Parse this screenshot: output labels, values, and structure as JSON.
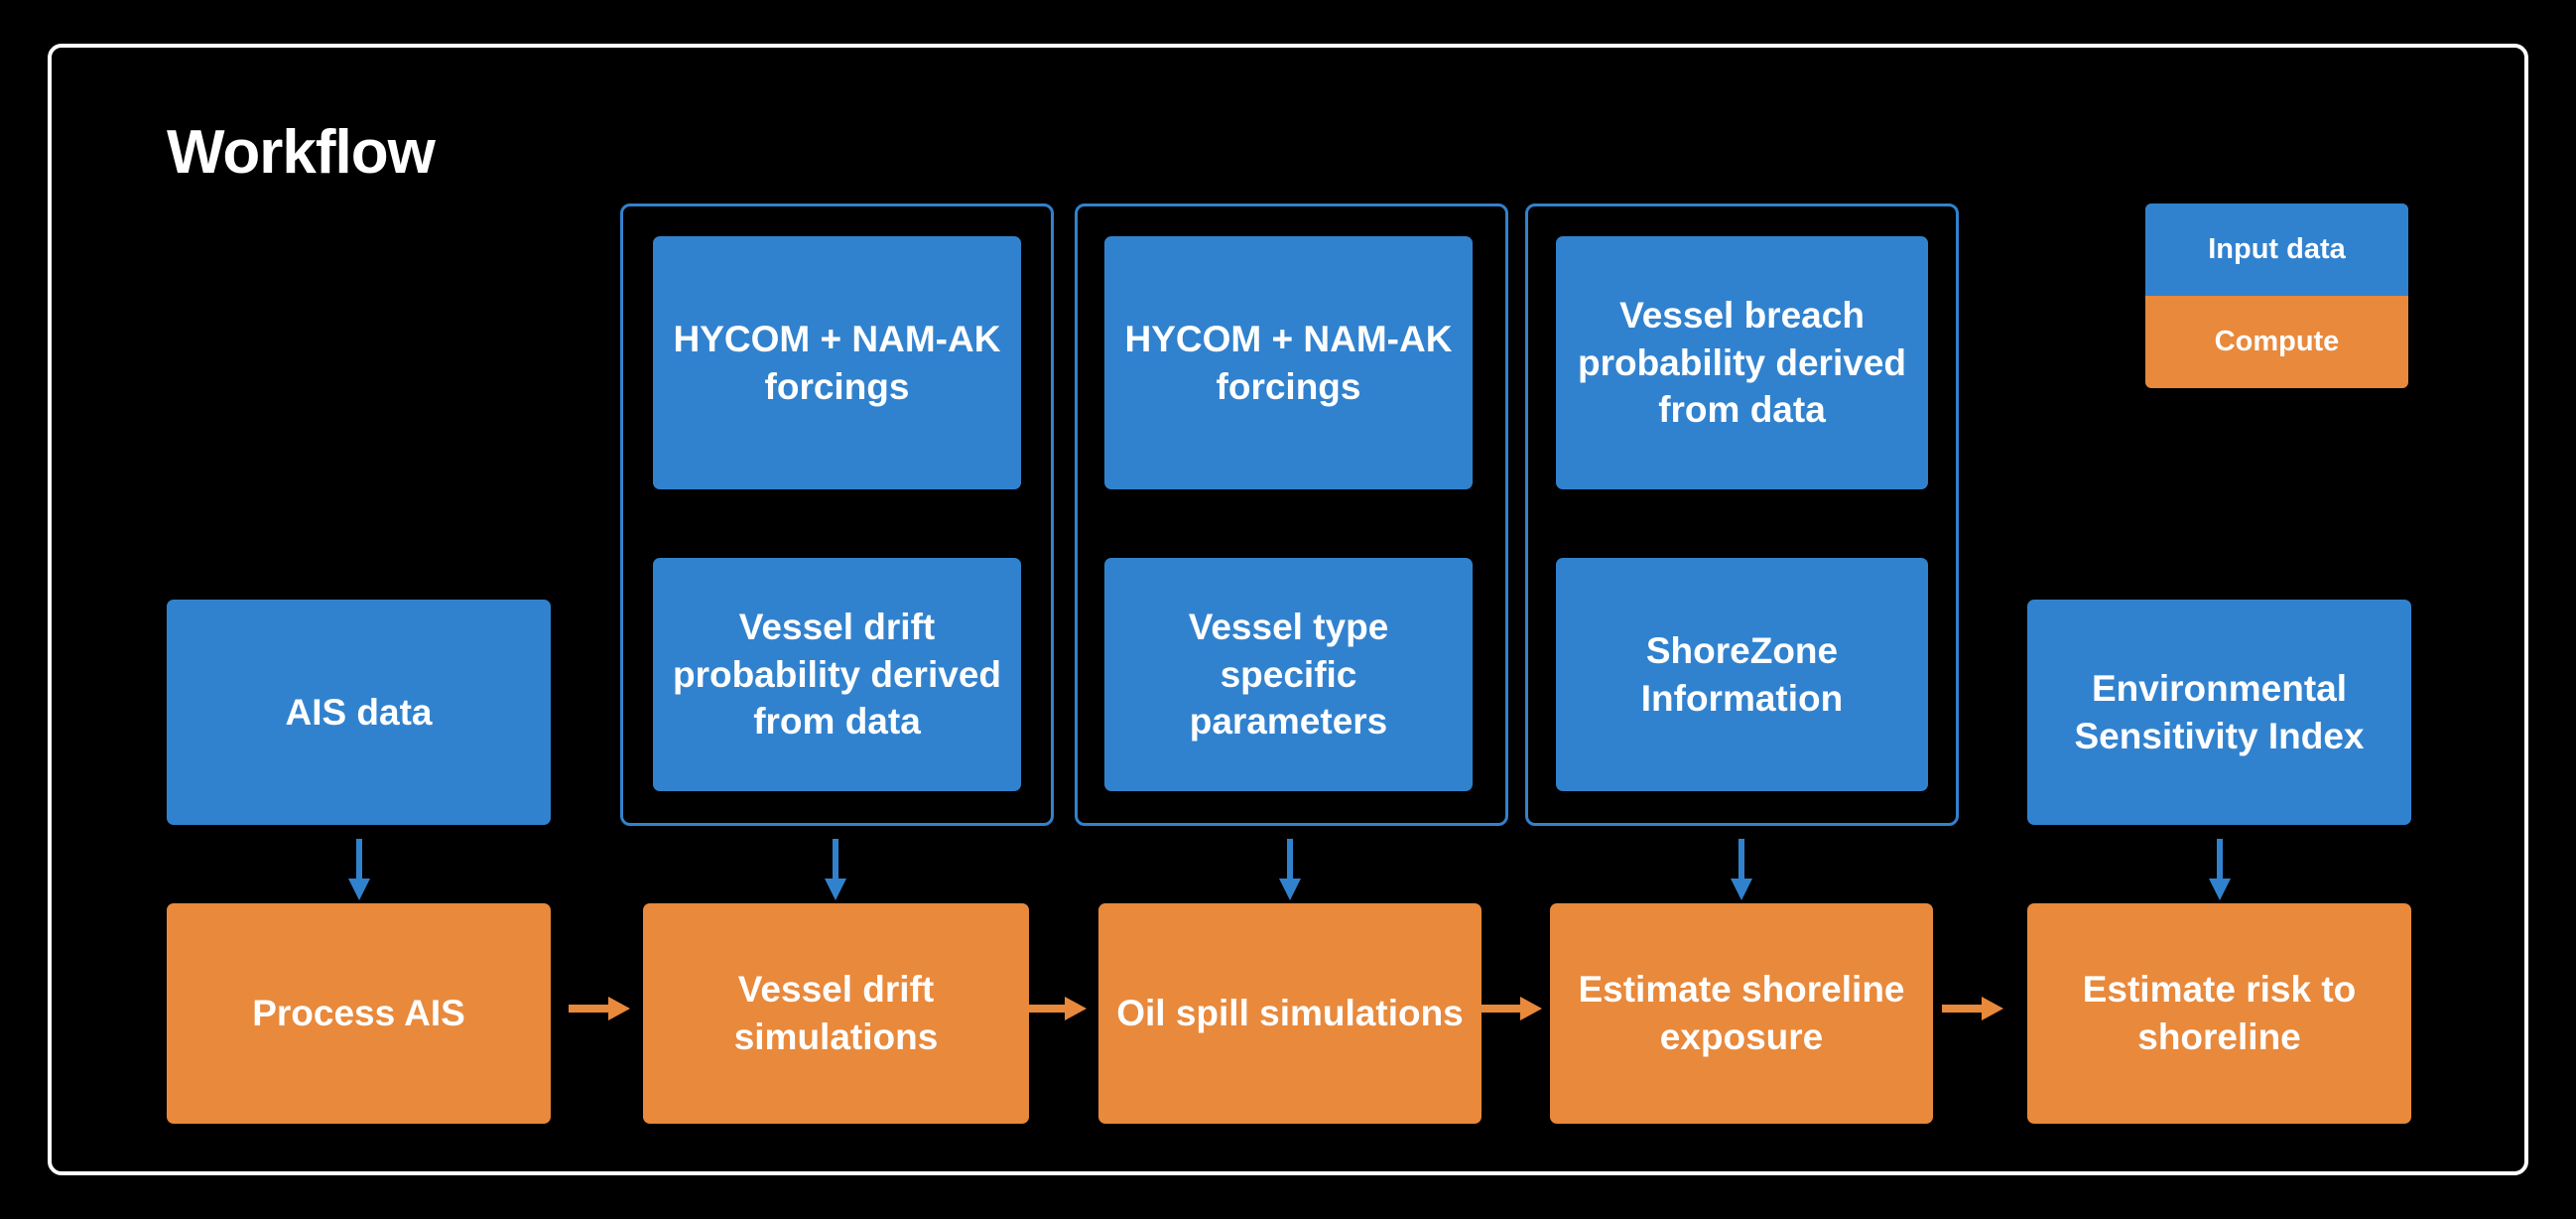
{
  "diagram": {
    "title": "Workflow",
    "background_color": "#000000",
    "frame_border_color": "#ffffff",
    "input_color": "#3182ce",
    "compute_color": "#e8893c",
    "text_color": "#ffffff"
  },
  "legend": {
    "items": [
      {
        "label": "Input data",
        "color": "#3182ce"
      },
      {
        "label": "Compute",
        "color": "#e8893c"
      }
    ]
  },
  "inputs": {
    "ais_data": "AIS data",
    "hycom_a": "HYCOM + NAM-AK forcings",
    "vessel_drift_probability": "Vessel drift probability derived from data",
    "hycom_b": "HYCOM + NAM-AK forcings",
    "vessel_type_parameters": "Vessel type specific parameters",
    "vessel_breach_probability": "Vessel breach probability derived from data",
    "shorezone_information": "ShoreZone Information",
    "environmental_sensitivity_index": "Environmental Sensitivity Index"
  },
  "compute": {
    "process_ais": "Process AIS",
    "vessel_drift_simulations": "Vessel drift simulations",
    "oil_spill_simulations": "Oil spill simulations",
    "estimate_shoreline_exposure": "Estimate shoreline exposure",
    "estimate_risk_to_shoreline": "Estimate risk to shoreline"
  }
}
